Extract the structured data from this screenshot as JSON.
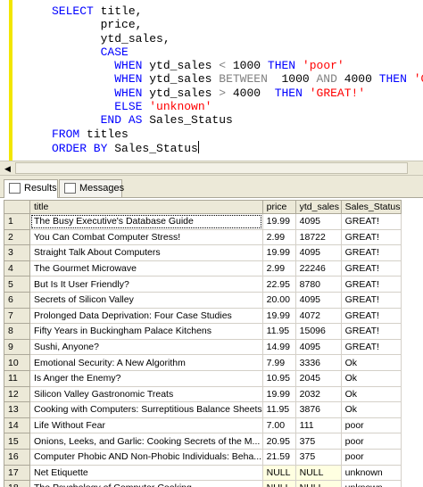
{
  "editor": {
    "lines": [
      [
        {
          "c": "kw",
          "t": "SELECT"
        },
        {
          "c": "",
          "t": " title,"
        }
      ],
      [
        {
          "c": "",
          "t": "       price,"
        }
      ],
      [
        {
          "c": "",
          "t": "       ytd_sales,"
        }
      ],
      [
        {
          "c": "",
          "t": "       "
        },
        {
          "c": "kw",
          "t": "CASE"
        }
      ],
      [
        {
          "c": "",
          "t": "         "
        },
        {
          "c": "kw",
          "t": "WHEN"
        },
        {
          "c": "",
          "t": " ytd_sales "
        },
        {
          "c": "op",
          "t": "<"
        },
        {
          "c": "",
          "t": " 1000 "
        },
        {
          "c": "kw",
          "t": "THEN"
        },
        {
          "c": "",
          "t": " "
        },
        {
          "c": "str",
          "t": "'poor'"
        }
      ],
      [
        {
          "c": "",
          "t": "         "
        },
        {
          "c": "kw",
          "t": "WHEN"
        },
        {
          "c": "",
          "t": " ytd_sales "
        },
        {
          "c": "op",
          "t": "BETWEEN"
        },
        {
          "c": "",
          "t": "  1000 "
        },
        {
          "c": "op",
          "t": "AND"
        },
        {
          "c": "",
          "t": " 4000 "
        },
        {
          "c": "kw",
          "t": "THEN"
        },
        {
          "c": "",
          "t": " "
        },
        {
          "c": "str",
          "t": "'Ok'"
        }
      ],
      [
        {
          "c": "",
          "t": "         "
        },
        {
          "c": "kw",
          "t": "WHEN"
        },
        {
          "c": "",
          "t": " ytd_sales "
        },
        {
          "c": "op",
          "t": ">"
        },
        {
          "c": "",
          "t": " 4000  "
        },
        {
          "c": "kw",
          "t": "THEN"
        },
        {
          "c": "",
          "t": " "
        },
        {
          "c": "str",
          "t": "'GREAT!'"
        }
      ],
      [
        {
          "c": "",
          "t": "         "
        },
        {
          "c": "kw",
          "t": "ELSE"
        },
        {
          "c": "",
          "t": " "
        },
        {
          "c": "str",
          "t": "'unknown'"
        }
      ],
      [
        {
          "c": "",
          "t": "       "
        },
        {
          "c": "kw",
          "t": "END AS"
        },
        {
          "c": "",
          "t": " Sales_Status"
        }
      ],
      [
        {
          "c": "kw",
          "t": "FROM"
        },
        {
          "c": "",
          "t": " titles"
        }
      ],
      [
        {
          "c": "kw",
          "t": "ORDER BY"
        },
        {
          "c": "",
          "t": " Sales_Status"
        }
      ]
    ]
  },
  "tabs": {
    "results_label": "Results",
    "messages_label": "Messages"
  },
  "grid": {
    "columns": [
      "title",
      "price",
      "ytd_sales",
      "Sales_Status"
    ],
    "rows": [
      [
        "1",
        "The Busy Executive's Database Guide",
        "19.99",
        "4095",
        "GREAT!"
      ],
      [
        "2",
        "You Can Combat Computer Stress!",
        "2.99",
        "18722",
        "GREAT!"
      ],
      [
        "3",
        "Straight Talk About Computers",
        "19.99",
        "4095",
        "GREAT!"
      ],
      [
        "4",
        "The Gourmet Microwave",
        "2.99",
        "22246",
        "GREAT!"
      ],
      [
        "5",
        "But Is It User Friendly?",
        "22.95",
        "8780",
        "GREAT!"
      ],
      [
        "6",
        "Secrets of Silicon Valley",
        "20.00",
        "4095",
        "GREAT!"
      ],
      [
        "7",
        "Prolonged Data Deprivation: Four Case Studies",
        "19.99",
        "4072",
        "GREAT!"
      ],
      [
        "8",
        "Fifty Years in Buckingham Palace Kitchens",
        "11.95",
        "15096",
        "GREAT!"
      ],
      [
        "9",
        "Sushi, Anyone?",
        "14.99",
        "4095",
        "GREAT!"
      ],
      [
        "10",
        "Emotional Security: A New Algorithm",
        "7.99",
        "3336",
        "Ok"
      ],
      [
        "11",
        "Is Anger the Enemy?",
        "10.95",
        "2045",
        "Ok"
      ],
      [
        "12",
        "Silicon Valley Gastronomic Treats",
        "19.99",
        "2032",
        "Ok"
      ],
      [
        "13",
        "Cooking with Computers: Surreptitious Balance Sheets",
        "11.95",
        "3876",
        "Ok"
      ],
      [
        "14",
        "Life Without Fear",
        "7.00",
        "111",
        "poor"
      ],
      [
        "15",
        "Onions, Leeks, and Garlic: Cooking Secrets of the M...",
        "20.95",
        "375",
        "poor"
      ],
      [
        "16",
        "Computer Phobic AND Non-Phobic Individuals: Beha...",
        "21.59",
        "375",
        "poor"
      ],
      [
        "17",
        "Net Etiquette",
        "NULL",
        "NULL",
        "unknown"
      ],
      [
        "18",
        "The Psychology of Computer Cooking",
        "NULL",
        "NULL",
        "unknown"
      ]
    ]
  }
}
